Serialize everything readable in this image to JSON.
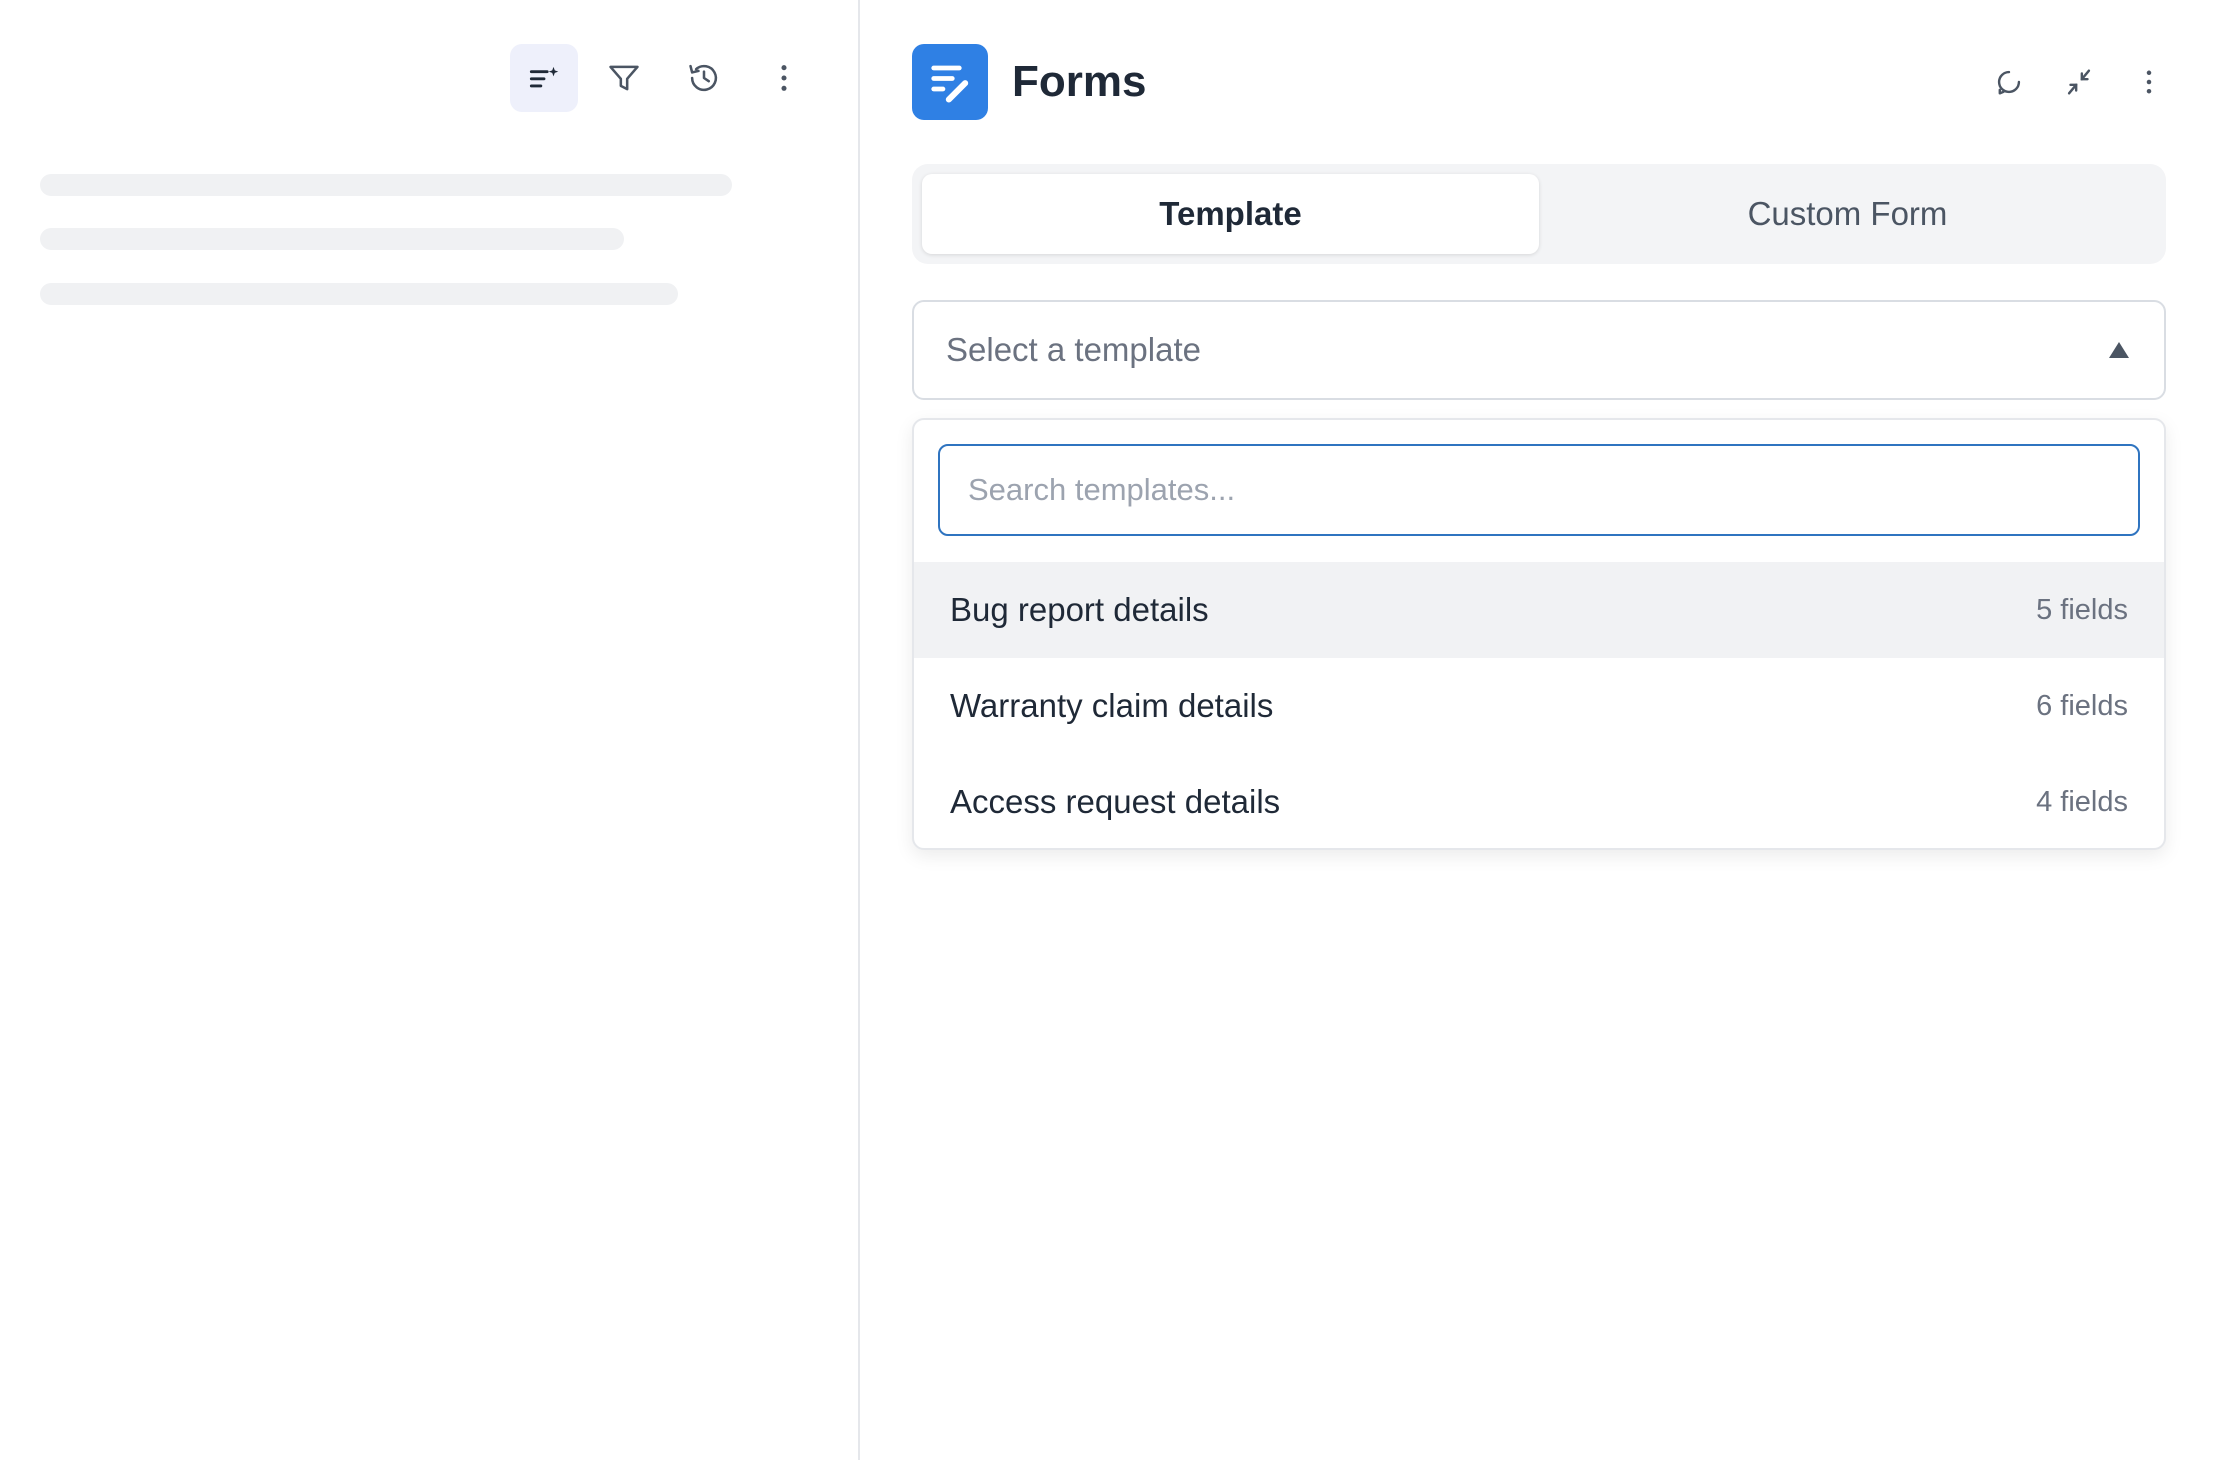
{
  "left": {
    "toolbar": {
      "icons": [
        "sort-sparkle-icon",
        "filter-icon",
        "history-icon",
        "more-vertical-icon"
      ],
      "active_index": 0
    }
  },
  "header": {
    "title": "Forms",
    "logo_icon": "form-edit-icon",
    "actions": [
      "refresh-icon",
      "collapse-icon",
      "more-vertical-icon"
    ]
  },
  "tabs": [
    {
      "label": "Template",
      "active": true
    },
    {
      "label": "Custom Form",
      "active": false
    }
  ],
  "select": {
    "placeholder": "Select a template",
    "open": true
  },
  "dropdown": {
    "search_placeholder": "Search templates...",
    "search_value": "",
    "options": [
      {
        "label": "Bug report details",
        "count": "5 fields",
        "highlighted": true
      },
      {
        "label": "Warranty claim details",
        "count": "6 fields",
        "highlighted": false
      },
      {
        "label": "Access request details",
        "count": "4 fields",
        "highlighted": false
      }
    ]
  },
  "colors": {
    "accent": "#2f80e4",
    "focus_border": "#2f74c0",
    "toolbar_active_bg": "#eef0fb",
    "text_primary": "#1f2937",
    "text_muted": "#6b7280"
  }
}
